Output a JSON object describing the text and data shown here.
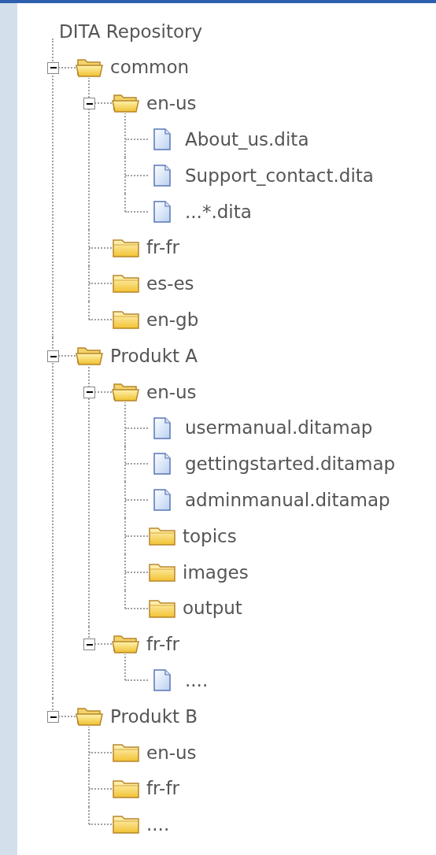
{
  "title": "DITA Repository",
  "tree": [
    {
      "kind": "folder",
      "label": "common",
      "expanded": true,
      "children": [
        {
          "kind": "folder",
          "label": "en-us",
          "expanded": true,
          "children": [
            {
              "kind": "file",
              "label": "About_us.dita"
            },
            {
              "kind": "file",
              "label": "Support_contact.dita"
            },
            {
              "kind": "file",
              "label": "...*.dita"
            }
          ]
        },
        {
          "kind": "folder",
          "label": "fr-fr"
        },
        {
          "kind": "folder",
          "label": "es-es"
        },
        {
          "kind": "folder",
          "label": "en-gb"
        }
      ]
    },
    {
      "kind": "folder",
      "label": "Produkt A",
      "expanded": true,
      "children": [
        {
          "kind": "folder",
          "label": "en-us",
          "expanded": true,
          "children": [
            {
              "kind": "file",
              "label": "usermanual.ditamap"
            },
            {
              "kind": "file",
              "label": "gettingstarted.ditamap"
            },
            {
              "kind": "file",
              "label": "adminmanual.ditamap"
            },
            {
              "kind": "folder",
              "label": "topics"
            },
            {
              "kind": "folder",
              "label": "images"
            },
            {
              "kind": "folder",
              "label": "output"
            }
          ]
        },
        {
          "kind": "folder",
          "label": "fr-fr",
          "expanded": true,
          "children": [
            {
              "kind": "file",
              "label": "...."
            }
          ]
        }
      ]
    },
    {
      "kind": "folder",
      "label": "Produkt B",
      "expanded": true,
      "children": [
        {
          "kind": "folder",
          "label": "en-us"
        },
        {
          "kind": "folder",
          "label": "fr-fr"
        },
        {
          "kind": "folder",
          "label": "...."
        }
      ]
    }
  ]
}
